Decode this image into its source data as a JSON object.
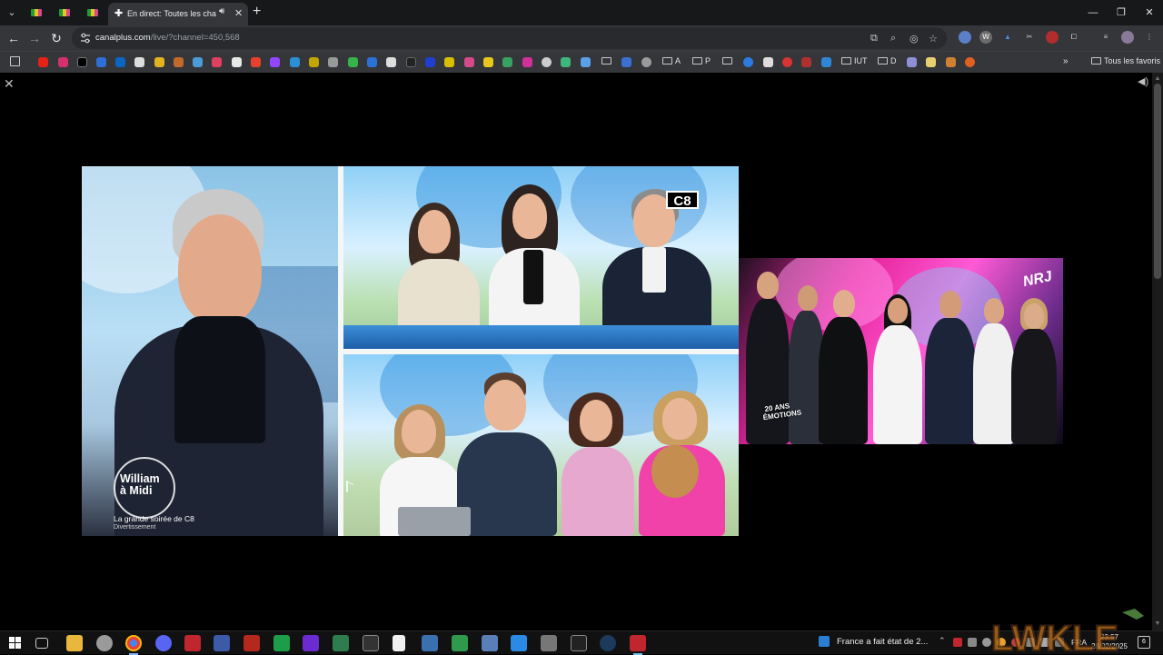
{
  "browser": {
    "active_tab": {
      "title": "En direct: Toutes les chaînes"
    },
    "url": {
      "host": "canalplus.com",
      "path": "/live/?channel=450,568"
    },
    "bookmarks": {
      "folders": [
        "A",
        "P",
        "IUT",
        "D"
      ],
      "all_bookmarks_label": "Tous les favoris"
    },
    "window_buttons": {
      "minimize": "—",
      "restore": "❐",
      "close": "✕"
    }
  },
  "player": {
    "channel_logo": "C8",
    "show_logo": "William\nà Midi",
    "caption_title": "La grande soirée de C8",
    "caption_genre": "Divertissement",
    "nrj_logo": "NRJ",
    "nrj_badge": "20 ANS ÉMOTIONS"
  },
  "taskbar": {
    "news": "France a fait état de 2...",
    "language": "FRA",
    "time": "23:57",
    "date": "28/02/2025",
    "notifications": "6"
  },
  "colors": {
    "chrome_dark": "#17181a",
    "toolbar": "#35363a",
    "accent_blue": "#76b9ed"
  }
}
